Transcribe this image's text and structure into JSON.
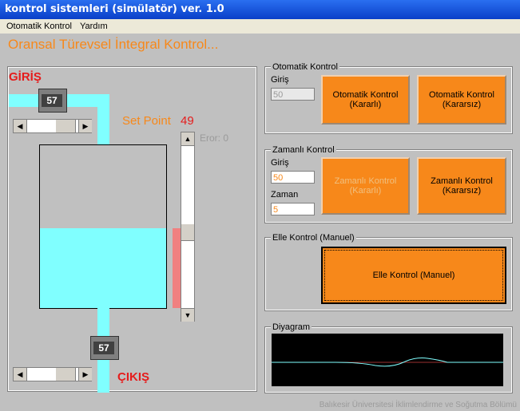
{
  "window": {
    "title": "kontrol sistemleri (simülatör) ver. 1.0"
  },
  "menu": {
    "items": [
      "Otomatik Kontrol",
      "Yardım"
    ]
  },
  "heading": "Oransal Türevsel İntegral Kontrol...",
  "sim": {
    "giris_label": "GİRİŞ",
    "cikis_label": "ÇIKIŞ",
    "pump_in_value": "57",
    "pump_out_value": "57",
    "setpoint_label": "Set Point",
    "setpoint_value": "49",
    "error_text": "Eror: 0",
    "tank_level": 0.49
  },
  "otomatik": {
    "title": "Otomatik Kontrol",
    "giris_label": "Giriş",
    "giris_value": "50",
    "btn_stable": "Otomatik Kontrol\n(Kararlı)",
    "btn_unstable": "Otomatik Kontrol\n(Kararsız)"
  },
  "zamanli": {
    "title": "Zamanlı Kontrol",
    "giris_label": "Giriş",
    "giris_value": "50",
    "zaman_label": "Zaman",
    "zaman_value": "5",
    "btn_stable": "Zamanlı Kontrol\n(Kararlı)",
    "btn_unstable": "Zamanlı Kontrol\n(Kararsız)"
  },
  "elle": {
    "title": "Elle Kontrol (Manuel)",
    "btn": "Elle Kontrol (Manuel)"
  },
  "diyagram": {
    "title": "Diyagram"
  },
  "footer": "Balıkesir Üniversitesi İklimlendirme ve Soğutma Bölümü",
  "colors": {
    "accent": "#f7881a",
    "water": "#80ffff",
    "level_bar": "#f08080",
    "alert": "#e51c1c"
  }
}
